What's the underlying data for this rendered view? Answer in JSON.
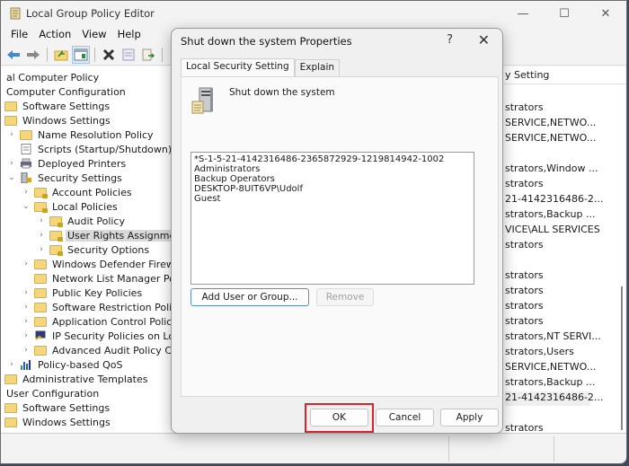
{
  "window": {
    "title": "Local Group Policy Editor",
    "controls": {
      "minimize": "—",
      "maximize": "☐",
      "close": "✕"
    }
  },
  "menu": [
    "File",
    "Action",
    "View",
    "Help"
  ],
  "toolbar": {
    "buttons": [
      "back-icon",
      "forward-icon",
      "up-folder-icon",
      "show-hide-tree-icon",
      "delete-icon",
      "properties-icon",
      "export-list-icon",
      "help-icon"
    ]
  },
  "tree": [
    {
      "label": "al Computer Policy",
      "level": 0,
      "icon": "none"
    },
    {
      "label": "Computer Configuration",
      "level": 0,
      "icon": "none"
    },
    {
      "label": "Software Settings",
      "level": 1,
      "icon": "folder"
    },
    {
      "label": "Windows Settings",
      "level": 1,
      "icon": "folder"
    },
    {
      "label": "Name Resolution Policy",
      "level": 2,
      "icon": "folder",
      "chevron": ">"
    },
    {
      "label": "Scripts (Startup/Shutdown)",
      "level": 2,
      "icon": "script"
    },
    {
      "label": "Deployed Printers",
      "level": 2,
      "icon": "printer",
      "chevron": ">"
    },
    {
      "label": "Security Settings",
      "level": 2,
      "icon": "security",
      "chevron": "v"
    },
    {
      "label": "Account Policies",
      "level": 3,
      "icon": "folder-lock",
      "chevron": ">"
    },
    {
      "label": "Local Policies",
      "level": 3,
      "icon": "folder-lock",
      "chevron": "v"
    },
    {
      "label": "Audit Policy",
      "level": 4,
      "icon": "folder-lock",
      "chevron": ">"
    },
    {
      "label": "User Rights Assignment",
      "level": 4,
      "icon": "folder-lock",
      "chevron": ">",
      "selected": true
    },
    {
      "label": "Security Options",
      "level": 4,
      "icon": "folder-lock",
      "chevron": ">"
    },
    {
      "label": "Windows Defender Firewall v",
      "level": 3,
      "icon": "folder",
      "chevron": ">"
    },
    {
      "label": "Network List Manager Policie",
      "level": 3,
      "icon": "folder"
    },
    {
      "label": "Public Key Policies",
      "level": 3,
      "icon": "folder",
      "chevron": ">"
    },
    {
      "label": "Software Restriction Policies",
      "level": 3,
      "icon": "folder",
      "chevron": ">"
    },
    {
      "label": "Application Control Policies",
      "level": 3,
      "icon": "folder",
      "chevron": ">"
    },
    {
      "label": "IP Security Policies on Local",
      "level": 3,
      "icon": "ipsec",
      "chevron": ">"
    },
    {
      "label": "Advanced Audit Policy Confi",
      "level": 3,
      "icon": "folder",
      "chevron": ">"
    },
    {
      "label": "Policy-based QoS",
      "level": 2,
      "icon": "chart",
      "chevron": ">"
    },
    {
      "label": "Administrative Templates",
      "level": 1,
      "icon": "folder"
    },
    {
      "label": "User Configuration",
      "level": 0,
      "icon": "none"
    },
    {
      "label": "Software Settings",
      "level": 1,
      "icon": "folder"
    },
    {
      "label": "Windows Settings",
      "level": 1,
      "icon": "folder"
    }
  ],
  "right_pane": {
    "header": "y Setting",
    "rows": [
      "",
      "strators",
      "SERVICE,NETWO...",
      "SERVICE,NETWO...",
      "",
      "strators,Window ...",
      "strators",
      "21-4142316486-2...",
      "strators,Backup ...",
      "VICE\\ALL SERVICES",
      "strators",
      "",
      "strators",
      "strators",
      "strators",
      "strators",
      "strators,NT SERVI...",
      "strators,Users",
      "SERVICE,NETWO...",
      "strators,Backup ...",
      "21-4142316486-2...",
      "",
      "strators"
    ],
    "highlighted_row": 20
  },
  "dialog": {
    "title": "Shut down the system Properties",
    "help": "?",
    "close": "✕",
    "tabs": [
      {
        "label": "Local Security Setting",
        "active": true
      },
      {
        "label": "Explain",
        "active": false
      }
    ],
    "policy_name": "Shut down the system",
    "members": [
      "*S-1-5-21-4142316486-2365872929-1219814942-1002",
      "Administrators",
      "Backup Operators",
      "DESKTOP-8UIT6VP\\Udolf",
      "Guest"
    ],
    "add_button": "Add User or Group...",
    "remove_button": "Remove",
    "ok_button": "OK",
    "cancel_button": "Cancel",
    "apply_button": "Apply",
    "annotation_color": "#d9232d"
  }
}
